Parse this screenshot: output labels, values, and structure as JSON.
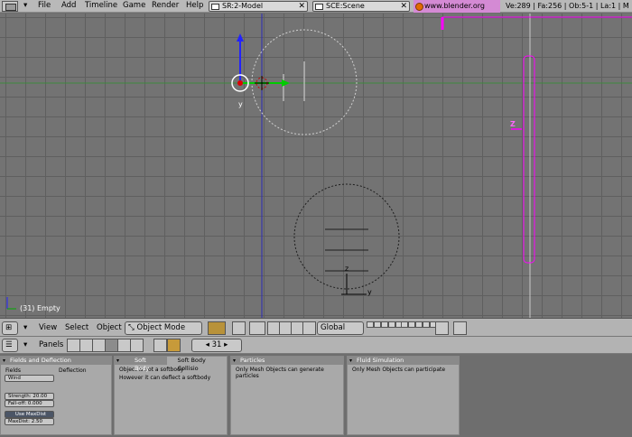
{
  "menubar": {
    "items": [
      "File",
      "Add",
      "Timeline",
      "Game",
      "Render",
      "Help"
    ],
    "screen": "SR:2-Model",
    "scene": "SCE:Scene",
    "link": "www.blender.org 243",
    "stats": "Ve:289 | Fa:256 | Ob:5-1 | La:1 | M"
  },
  "viewport": {
    "status": "(31) Empty",
    "axis_y": "y",
    "axis_z": "z",
    "label_z": "Z",
    "colors": {
      "grid": "#5f5f5f",
      "select": "#ff00ff",
      "x_axis": "#00aa00",
      "y_axis": "#0000ff"
    }
  },
  "view_header": {
    "menus": [
      "View",
      "Select",
      "Object"
    ],
    "mode": "Object Mode",
    "orientation": "Global"
  },
  "buttons_header": {
    "panels_label": "Panels",
    "frame": "31"
  },
  "panels": {
    "fields": {
      "title": "Fields and Deflection",
      "fields_label": "Fields",
      "deflection_label": "Deflection",
      "field_type": "Wind",
      "strength": "Strength: 20.00",
      "falloff": "Fall-off: 0.000",
      "use_maxdist": "Use MaxDist",
      "maxdist": "MaxDist: 2.50"
    },
    "softbody": {
      "tab1": "Soft Body",
      "tab2": "Soft Body Collisio",
      "line1": "Object is not a softbody",
      "line2": "However it can deflect a softbody"
    },
    "particles": {
      "title": "Particles",
      "text": "Only Mesh Objects can generate particles"
    },
    "fluid": {
      "title": "Fluid Simulation",
      "text": "Only Mesh Objects can participate"
    }
  }
}
